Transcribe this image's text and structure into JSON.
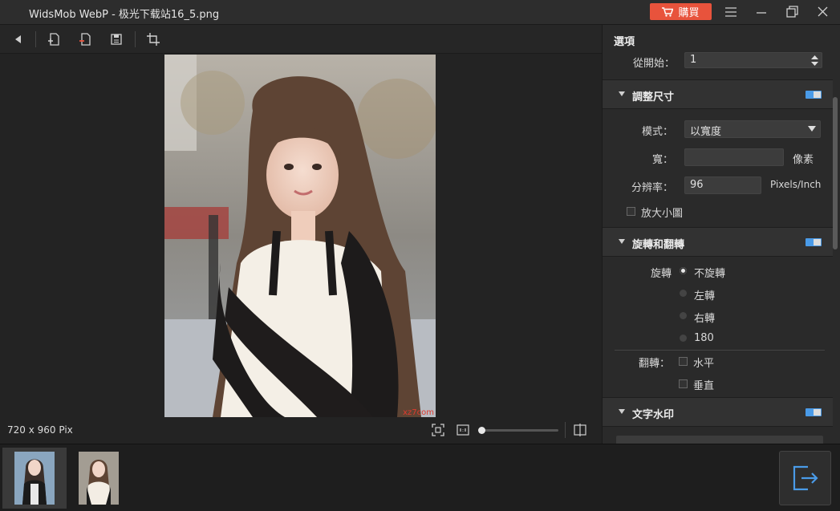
{
  "window": {
    "title": "WidsMob WebP - 极光下载站16_5.png",
    "buy_label": "購買",
    "buy_color": "#e8533c"
  },
  "toolbar": {
    "icons": [
      "back-arrow-icon",
      "add-file-icon",
      "remove-file-icon",
      "save-icon",
      "crop-icon"
    ]
  },
  "image": {
    "dimensions_label": "720 x 960 Pix",
    "watermark": "xz7com",
    "zoom_level": 0
  },
  "panel": {
    "title": "選項",
    "start_from_label": "從開始：",
    "start_from_value": "1",
    "resize": {
      "title": "調整尺寸",
      "mode_label": "模式：",
      "mode_value": "以寬度",
      "width_label": "寬：",
      "width_value": "",
      "width_unit": "像素",
      "resolution_label": "分辨率：",
      "resolution_value": "96",
      "resolution_unit": "Pixels/Inch",
      "enlarge_label": "放大小圖"
    },
    "rotate_flip": {
      "title": "旋轉和翻轉",
      "rotate_label": "旋轉",
      "rotate_options": [
        "不旋轉",
        "左轉",
        "右轉",
        "180"
      ],
      "selected_rotation": "不旋轉",
      "flip_label": "翻轉：",
      "flip_horizontal": "水平",
      "flip_vertical": "垂直"
    },
    "watermark": {
      "title": "文字水印"
    },
    "accent_color": "#4a9be8"
  }
}
